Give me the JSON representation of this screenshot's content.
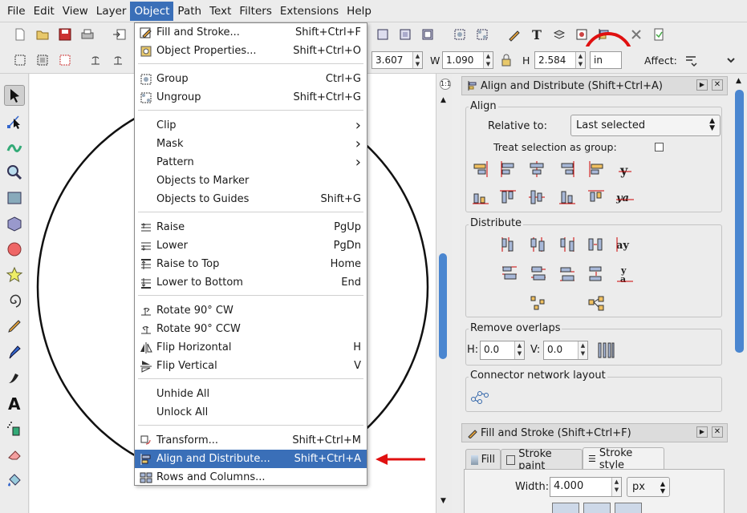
{
  "menubar": {
    "items": [
      "File",
      "Edit",
      "View",
      "Layer",
      "Object",
      "Path",
      "Text",
      "Filters",
      "Extensions",
      "Help"
    ],
    "active_index": 4
  },
  "toolbar2": {
    "x_value": "3.607",
    "w_label": "W",
    "w_value": "1.090",
    "h_label": "H",
    "h_value": "2.584",
    "unit": "in",
    "affect_label": "Affect:"
  },
  "object_menu": {
    "items": [
      {
        "label": "Fill and Stroke...",
        "shortcut": "Shift+Ctrl+F",
        "icon": "fill-stroke-icon"
      },
      {
        "label": "Object Properties...",
        "shortcut": "Shift+Ctrl+O",
        "icon": "object-properties-icon"
      },
      {
        "label": "Group",
        "shortcut": "Ctrl+G",
        "icon": "group-icon"
      },
      {
        "label": "Ungroup",
        "shortcut": "Shift+Ctrl+G",
        "icon": "ungroup-icon"
      },
      {
        "label": "Clip",
        "shortcut": "›",
        "icon": ""
      },
      {
        "label": "Mask",
        "shortcut": "›",
        "icon": ""
      },
      {
        "label": "Pattern",
        "shortcut": "›",
        "icon": ""
      },
      {
        "label": "Objects to Marker",
        "shortcut": "",
        "icon": ""
      },
      {
        "label": "Objects to Guides",
        "shortcut": "Shift+G",
        "icon": ""
      },
      {
        "label": "Raise",
        "shortcut": "PgUp",
        "icon": "raise-icon"
      },
      {
        "label": "Lower",
        "shortcut": "PgDn",
        "icon": "lower-icon"
      },
      {
        "label": "Raise to Top",
        "shortcut": "Home",
        "icon": "raise-top-icon"
      },
      {
        "label": "Lower to Bottom",
        "shortcut": "End",
        "icon": "lower-bottom-icon"
      },
      {
        "label": "Rotate 90° CW",
        "shortcut": "",
        "icon": "rotate-cw-icon"
      },
      {
        "label": "Rotate 90° CCW",
        "shortcut": "",
        "icon": "rotate-ccw-icon"
      },
      {
        "label": "Flip Horizontal",
        "shortcut": "H",
        "icon": "flip-horizontal-icon"
      },
      {
        "label": "Flip Vertical",
        "shortcut": "V",
        "icon": "flip-vertical-icon"
      },
      {
        "label": "Unhide All",
        "shortcut": "",
        "icon": ""
      },
      {
        "label": "Unlock All",
        "shortcut": "",
        "icon": ""
      },
      {
        "label": "Transform...",
        "shortcut": "Shift+Ctrl+M",
        "icon": "transform-icon"
      },
      {
        "label": "Align and Distribute...",
        "shortcut": "Shift+Ctrl+A",
        "icon": "align-distribute-icon"
      },
      {
        "label": "Rows and Columns...",
        "shortcut": "",
        "icon": "rows-columns-icon"
      }
    ],
    "highlighted_index": 20
  },
  "align_dialog": {
    "title": "Align and Distribute (Shift+Ctrl+A)",
    "align_section": "Align",
    "relative_to_label": "Relative to:",
    "relative_to_value": "Last selected",
    "treat_group_label": "Treat selection as group:",
    "distribute_section": "Distribute",
    "remove_overlaps_section": "Remove overlaps",
    "h_label": "H:",
    "h_value": "0.0",
    "v_label": "V:",
    "v_value": "0.0",
    "connector_section": "Connector network layout"
  },
  "fill_dialog": {
    "title": "Fill and Stroke (Shift+Ctrl+F)",
    "tabs": [
      "Fill",
      "Stroke paint",
      "Stroke style"
    ],
    "active_tab": 2,
    "width_label": "Width:",
    "width_value": "4.000",
    "width_unit": "px"
  },
  "colors": {
    "highlight": "#3a6fb8",
    "annotation": "#e01010",
    "scroll": "#4a86d0"
  }
}
